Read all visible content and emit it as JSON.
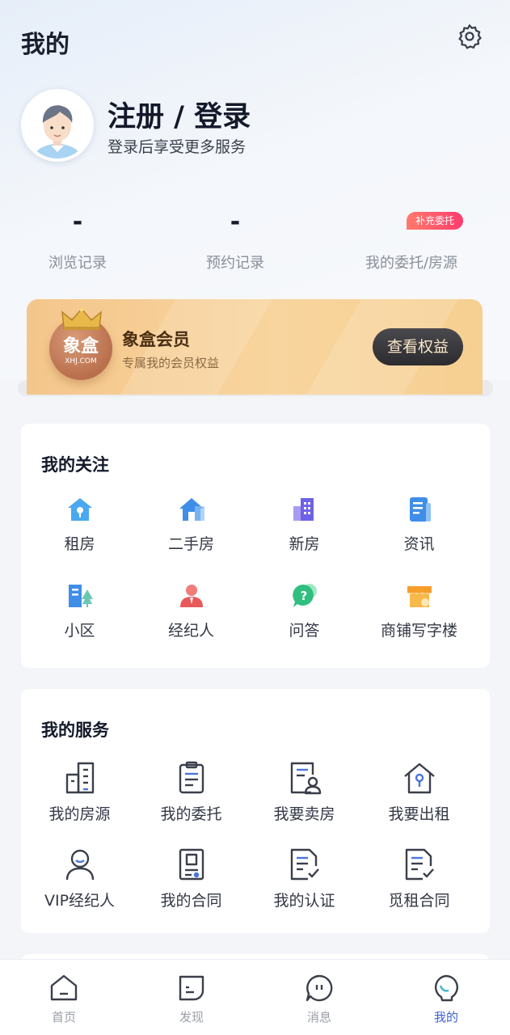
{
  "header": {
    "title": "我的"
  },
  "profile": {
    "title": "注册 / 登录",
    "subtitle": "登录后享受更多服务"
  },
  "stats": [
    {
      "value": "-",
      "label": "浏览记录"
    },
    {
      "value": "-",
      "label": "预约记录"
    },
    {
      "value": "",
      "label": "我的委托/房源",
      "badge": "补充委托"
    }
  ],
  "vip": {
    "logo_text": "象盒",
    "logo_sub": "XHJ.COM",
    "title": "象盒会员",
    "subtitle": "专属我的会员权益",
    "button": "查看权益"
  },
  "follow": {
    "title": "我的关注",
    "items": [
      {
        "label": "租房",
        "icon": "rent-house-icon"
      },
      {
        "label": "二手房",
        "icon": "second-hand-house-icon"
      },
      {
        "label": "新房",
        "icon": "new-house-icon"
      },
      {
        "label": "资讯",
        "icon": "news-icon"
      },
      {
        "label": "小区",
        "icon": "community-icon"
      },
      {
        "label": "经纪人",
        "icon": "agent-icon"
      },
      {
        "label": "问答",
        "icon": "qa-icon"
      },
      {
        "label": "商铺写字楼",
        "icon": "shop-office-icon"
      }
    ]
  },
  "services": {
    "title": "我的服务",
    "items": [
      {
        "label": "我的房源",
        "icon": "my-listings-icon"
      },
      {
        "label": "我的委托",
        "icon": "my-entrust-icon"
      },
      {
        "label": "我要卖房",
        "icon": "sell-house-icon"
      },
      {
        "label": "我要出租",
        "icon": "rent-out-icon"
      },
      {
        "label": "VIP经纪人",
        "icon": "vip-agent-icon"
      },
      {
        "label": "我的合同",
        "icon": "contract-icon"
      },
      {
        "label": "我的认证",
        "icon": "certification-icon"
      },
      {
        "label": "觅租合同",
        "icon": "rent-contract-icon"
      }
    ]
  },
  "tabbar": [
    {
      "label": "首页",
      "icon": "home-icon",
      "active": false
    },
    {
      "label": "发现",
      "icon": "discover-icon",
      "active": false
    },
    {
      "label": "消息",
      "icon": "message-icon",
      "active": false
    },
    {
      "label": "我的",
      "icon": "mine-icon",
      "active": true
    }
  ],
  "colors": {
    "accent": "#3d5fcf",
    "vip_gold": "#f6cf91",
    "badge": "#ff3c6e"
  }
}
